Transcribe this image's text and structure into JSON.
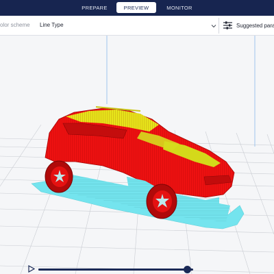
{
  "nav": {
    "tabs": [
      {
        "label": "PREPARE",
        "active": false
      },
      {
        "label": "PREVIEW",
        "active": true
      },
      {
        "label": "MONITOR",
        "active": false
      }
    ]
  },
  "toolbar": {
    "color_scheme_label": "olor scheme",
    "color_scheme_value": "Line Type",
    "settings_label": "Suggested param"
  },
  "preview": {
    "layer_progress": 0.96,
    "colors": {
      "nav_bg": "#172550",
      "wall_outer": "#ee1111",
      "top_skin": "#e7e41a",
      "skirt_support": "#74e4ee",
      "build_plate": "#f5f6f8"
    }
  }
}
